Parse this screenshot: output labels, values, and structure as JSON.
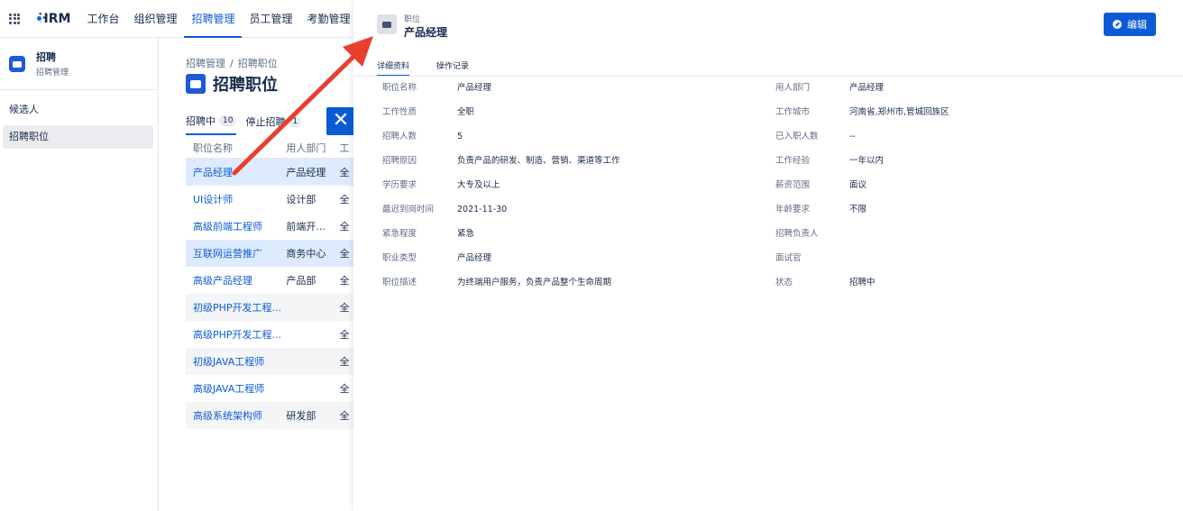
{
  "topnav": {
    "brand": "HRM",
    "items": [
      "工作台",
      "组织管理",
      "招聘管理",
      "员工管理",
      "考勤管理"
    ]
  },
  "sidebar": {
    "title": "招聘",
    "subtitle": "招聘管理",
    "items": [
      "候选人",
      "招聘职位"
    ]
  },
  "main": {
    "breadcrumb": [
      "招聘管理",
      "招聘职位"
    ],
    "title": "招聘职位",
    "tabs": [
      {
        "label": "招聘中",
        "count": "10"
      },
      {
        "label": "停止招聘",
        "count": "1"
      }
    ],
    "columns": [
      "职位名称",
      "用人部门",
      "工"
    ],
    "rows": [
      {
        "name": "产品经理",
        "dept": "产品经理",
        "c3": "全"
      },
      {
        "name": "UI设计师",
        "dept": "设计部",
        "c3": "全"
      },
      {
        "name": "高级前端工程师",
        "dept": "前端开...",
        "c3": "全"
      },
      {
        "name": "互联网运营推广",
        "dept": "商务中心",
        "c3": "全"
      },
      {
        "name": "高级产品经理",
        "dept": "产品部",
        "c3": "全"
      },
      {
        "name": "初级PHP开发工程...",
        "dept": "",
        "c3": "全"
      },
      {
        "name": "高级PHP开发工程...",
        "dept": "",
        "c3": "全"
      },
      {
        "name": "初级JAVA工程师",
        "dept": "",
        "c3": "全"
      },
      {
        "name": "高级JAVA工程师",
        "dept": "",
        "c3": "全"
      },
      {
        "name": "高级系统架构师",
        "dept": "研发部",
        "c3": "全"
      }
    ]
  },
  "panel": {
    "label": "职位",
    "title": "产品经理",
    "edit_label": "编辑",
    "tabs": [
      "详细资料",
      "操作记录"
    ],
    "fields": [
      {
        "l1": "职位名称",
        "v1": "产品经理",
        "l2": "用人部门",
        "v2": "产品经理"
      },
      {
        "l1": "工作性质",
        "v1": "全职",
        "l2": "工作城市",
        "v2": "河南省,郑州市,管城回族区"
      },
      {
        "l1": "招聘人数",
        "v1": "5",
        "l2": "已入职人数",
        "v2": "--"
      },
      {
        "l1": "招聘原因",
        "v1": "负责产品的研发、制造、营销、渠道等工作",
        "l2": "工作经验",
        "v2": "一年以内"
      },
      {
        "l1": "学历要求",
        "v1": "大专及以上",
        "l2": "薪资范围",
        "v2": "面议"
      },
      {
        "l1": "最迟到岗时间",
        "v1": "2021-11-30",
        "l2": "年龄要求",
        "v2": "不限"
      },
      {
        "l1": "紧急程度",
        "v1": "紧急",
        "l2": "招聘负责人",
        "v2": ""
      },
      {
        "l1": "职业类型",
        "v1": "产品经理",
        "l2": "面试官",
        "v2": ""
      },
      {
        "l1": "职位描述",
        "v1": "为终端用户服务，负责产品整个生命周期",
        "l2": "状态",
        "v2": "招聘中"
      }
    ]
  },
  "colors": {
    "accent": "#0c5bd6",
    "arrow": "#e8402f",
    "selected_row": "#deebff"
  }
}
